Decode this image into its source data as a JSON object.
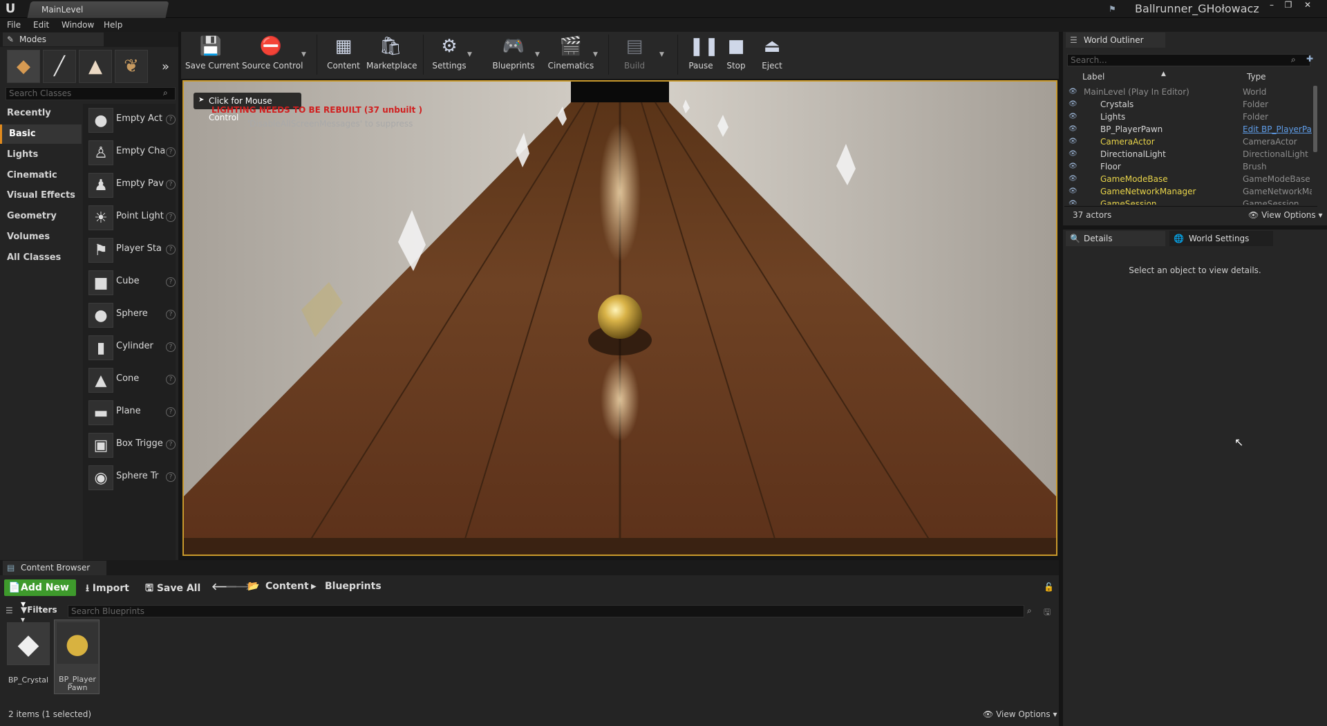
{
  "window": {
    "tab_title": "MainLevel",
    "project": "Ballrunner_GHołowacz",
    "controls": [
      "–",
      "❐",
      "✕"
    ]
  },
  "menu": [
    "File",
    "Edit",
    "Window",
    "Help"
  ],
  "modes": {
    "tab_label": "Modes",
    "search_placeholder": "Search Classes",
    "categories": [
      "Recently Placed",
      "Basic",
      "Lights",
      "Cinematic",
      "Visual Effects",
      "Geometry",
      "Volumes",
      "All Classes"
    ],
    "active_category": "Basic",
    "classes": [
      {
        "label": "Empty Act",
        "icon": "sphere-icon"
      },
      {
        "label": "Empty Cha",
        "icon": "character-icon"
      },
      {
        "label": "Empty Pav",
        "icon": "pawn-icon"
      },
      {
        "label": "Point Light",
        "icon": "bulb-icon"
      },
      {
        "label": "Player Sta",
        "icon": "player-start-icon"
      },
      {
        "label": "Cube",
        "icon": "cube-icon"
      },
      {
        "label": "Sphere",
        "icon": "sphere-icon"
      },
      {
        "label": "Cylinder",
        "icon": "cylinder-icon"
      },
      {
        "label": "Cone",
        "icon": "cone-icon"
      },
      {
        "label": "Plane",
        "icon": "plane-icon"
      },
      {
        "label": "Box Trigge",
        "icon": "box-trigger-icon"
      },
      {
        "label": "Sphere Tr",
        "icon": "sphere-trigger-icon"
      }
    ]
  },
  "toolbar": {
    "save_current": "Save Current",
    "source_control": "Source Control",
    "content": "Content",
    "marketplace": "Marketplace",
    "settings": "Settings",
    "blueprints": "Blueprints",
    "cinematics": "Cinematics",
    "build": "Build",
    "pause": "Pause",
    "stop": "Stop",
    "eject": "Eject"
  },
  "viewport": {
    "mouse_hint": "Click for Mouse Control",
    "lighting_warning": "LIGHTING NEEDS TO BE REBUILT (37 unbuilt )",
    "suppress_hint": "'DisableAllScreenMessages' to suppress"
  },
  "outliner": {
    "tab_label": "World Outliner",
    "search_placeholder": "Search...",
    "col_label": "Label",
    "col_type": "Type",
    "rows": [
      {
        "label": "MainLevel (Play In Editor)",
        "type": "World",
        "indent": 0,
        "color": "#8c8c8c"
      },
      {
        "label": "Crystals",
        "type": "Folder",
        "indent": 1,
        "color": "#d6d6d6"
      },
      {
        "label": "Lights",
        "type": "Folder",
        "indent": 1,
        "color": "#d6d6d6"
      },
      {
        "label": "BP_PlayerPawn",
        "type": "Edit BP_PlayerPawn",
        "indent": 1,
        "color": "#d6d6d6"
      },
      {
        "label": "CameraActor",
        "type": "CameraActor",
        "indent": 1,
        "color": "#e8d44a"
      },
      {
        "label": "DirectionalLight",
        "type": "DirectionalLight",
        "indent": 1,
        "color": "#d6d6d6"
      },
      {
        "label": "Floor",
        "type": "Brush",
        "indent": 1,
        "color": "#d6d6d6"
      },
      {
        "label": "GameModeBase",
        "type": "GameModeBase",
        "indent": 1,
        "color": "#e8d44a"
      },
      {
        "label": "GameNetworkManager",
        "type": "GameNetworkMan",
        "indent": 1,
        "color": "#e8d44a"
      },
      {
        "label": "GameSession",
        "type": "GameSession",
        "indent": 1,
        "color": "#e8d44a"
      }
    ],
    "actor_count": "37 actors",
    "view_options": "View Options"
  },
  "details": {
    "tab_label": "Details",
    "world_settings_label": "World Settings",
    "empty_message": "Select an object to view details."
  },
  "content_browser": {
    "tab_label": "Content Browser",
    "add_new": "Add New",
    "import": "Import",
    "save_all": "Save All",
    "path": [
      "Content",
      "Blueprints"
    ],
    "filters": "Filters",
    "search_placeholder": "Search Blueprints",
    "assets": [
      {
        "name": "BP_Crystal",
        "selected": false
      },
      {
        "name": "BP_Player\nPawn",
        "selected": true
      }
    ],
    "status": "2 items (1 selected)",
    "view_options": "View Options"
  }
}
